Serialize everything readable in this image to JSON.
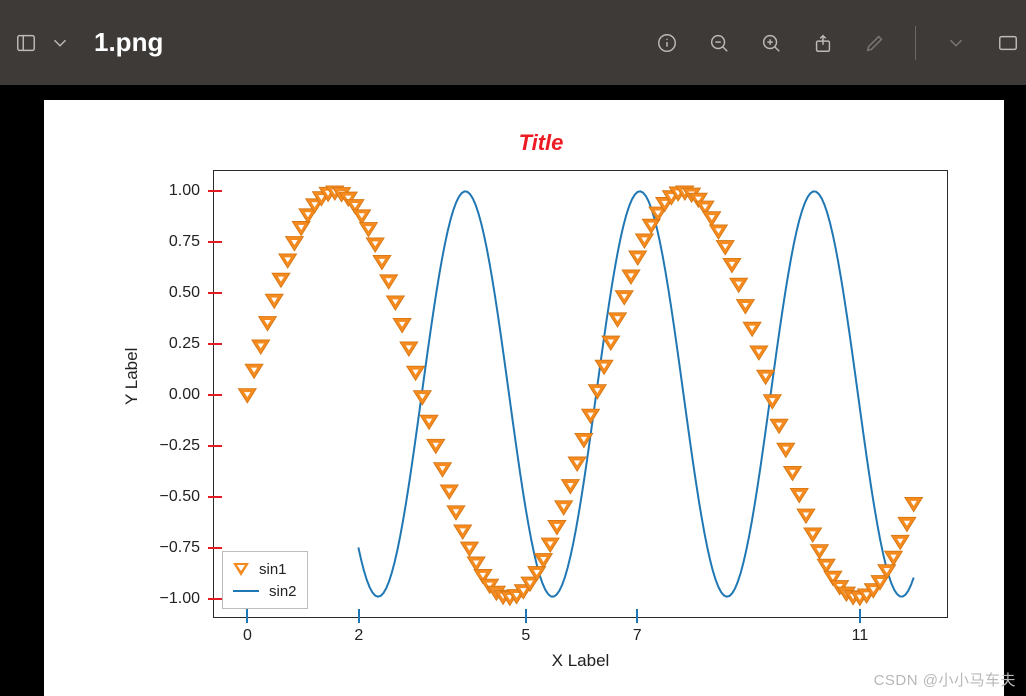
{
  "titlebar": {
    "filename": "1.png"
  },
  "watermark": "CSDN @小小马车夫",
  "chart_data": {
    "type": "line",
    "title": "Title",
    "xlabel": "X Label",
    "ylabel": "Y Label",
    "xlim": [
      -0.6,
      12.6
    ],
    "ylim": [
      -1.1,
      1.1
    ],
    "xticks": [
      0,
      2,
      5,
      7,
      11
    ],
    "yticks": [
      -1.0,
      -0.75,
      -0.5,
      -0.25,
      0.0,
      0.25,
      0.5,
      0.75,
      1.0
    ],
    "legend": [
      "sin1",
      "sin2"
    ],
    "series": [
      {
        "name": "sin1",
        "marker": "triangle_down",
        "color": "#f58a1f",
        "x_start": 0,
        "x_end": 12,
        "n": 100,
        "fn": "sin(x)"
      },
      {
        "name": "sin2",
        "line": true,
        "color": "#1f77b4",
        "x_start": 2,
        "x_end": 12,
        "n": 200,
        "fn": "sin(2*x)"
      }
    ]
  }
}
